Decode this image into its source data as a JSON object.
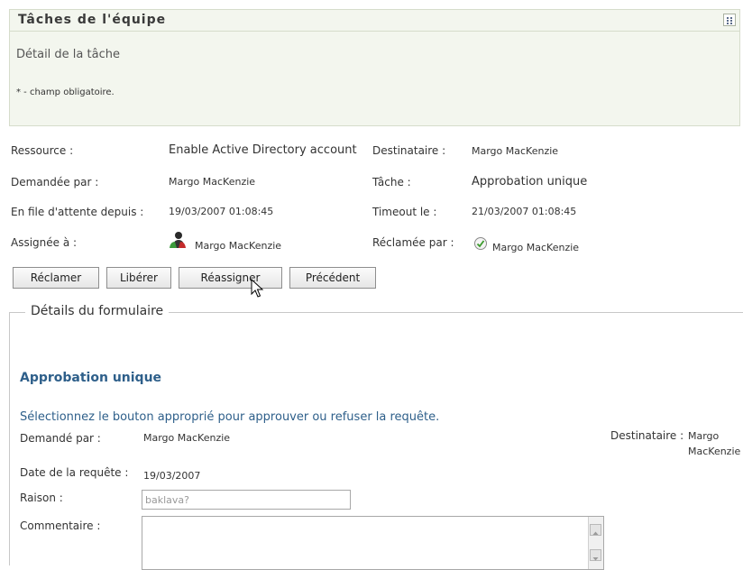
{
  "panel": {
    "title": "Tâches de l'équipe",
    "subtitle": "Détail de la tâche",
    "required_note": "* - champ obligatoire."
  },
  "task": {
    "resource_label": "Ressource :",
    "resource_value": "Enable Active Directory account",
    "recipient_label": "Destinataire :",
    "recipient_value": "Margo MacKenzie",
    "requested_by_label": "Demandée par :",
    "requested_by_value": "Margo MacKenzie",
    "task_label": "Tâche :",
    "task_value": "Approbation unique",
    "queued_label": "En file d'attente depuis :",
    "queued_value": "19/03/2007 01:08:45",
    "timeout_label": "Timeout le :",
    "timeout_value": "21/03/2007 01:08:45",
    "assigned_label": "Assignée à :",
    "assigned_value": "Margo MacKenzie",
    "claimed_label": "Réclamée par :",
    "claimed_value": "Margo MacKenzie"
  },
  "buttons": {
    "claim": "Réclamer",
    "release": "Libérer",
    "reassign": "Réassigner",
    "previous": "Précédent"
  },
  "form": {
    "legend": "Détails du formulaire",
    "title": "Approbation unique",
    "instruction": "Sélectionnez le bouton approprié pour approuver ou refuser la requête.",
    "requested_by_label": "Demandé par :",
    "requested_by_value": "Margo MacKenzie",
    "recipient_label": "Destinataire :",
    "recipient_value_line1": "Margo",
    "recipient_value_line2": "MacKenzie",
    "request_date_label": "Date de la requête :",
    "request_date_value": "19/03/2007",
    "reason_label": "Raison :",
    "reason_value": "baklava?",
    "comment_label": "Commentaire :",
    "comment_value": ""
  },
  "icons": {
    "panel_menu": "grid-menu-icon",
    "assigned": "user-group-icon",
    "claimed": "check-circle-icon",
    "cursor": "mouse-pointer-icon"
  }
}
